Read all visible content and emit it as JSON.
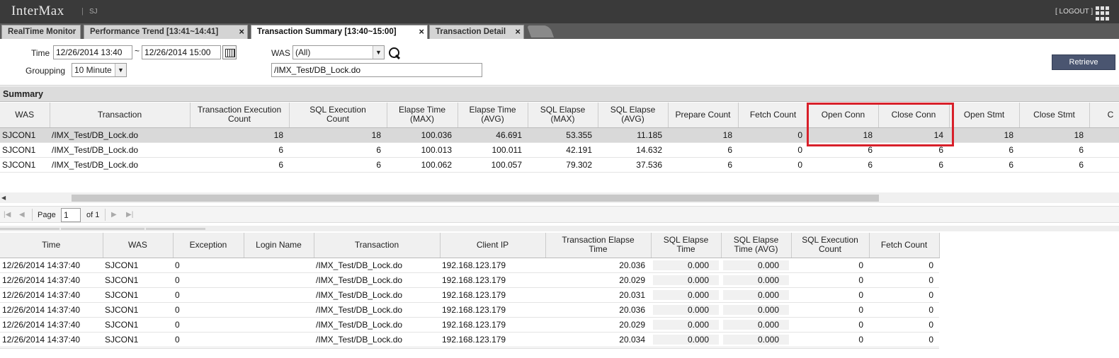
{
  "app": {
    "logo": "InterMax",
    "separator": "|",
    "user": "SJ",
    "logout": "[ LOGOUT ]"
  },
  "tabs": [
    {
      "label": "RealTime Monitor"
    },
    {
      "label": "Performance Trend [13:41~14:41]",
      "close": "×"
    },
    {
      "label": "Transaction Summary [13:40~15:00]",
      "close": "×"
    },
    {
      "label": "Transaction Detail",
      "close": "×"
    }
  ],
  "filter": {
    "time_label": "Time",
    "time_from": "12/26/2014 13:40",
    "time_sep": "~",
    "time_to": "12/26/2014 15:00",
    "grouping_label": "Groupping",
    "grouping_value": "10 Minute",
    "was_label": "WAS",
    "was_value": "(All)",
    "transaction_filter": "/IMX_Test/DB_Lock.do",
    "retrieve_label": "Retrieve"
  },
  "summary": {
    "title": "Summary",
    "columns": [
      [
        "WAS"
      ],
      [
        "Transaction"
      ],
      [
        "Transaction Execution",
        "Count"
      ],
      [
        "SQL Execution",
        "Count"
      ],
      [
        "Elapse Time",
        "(MAX)"
      ],
      [
        "Elapse Time",
        "(AVG)"
      ],
      [
        "SQL Elapse",
        "(MAX)"
      ],
      [
        "SQL Elapse",
        "(AVG)"
      ],
      [
        "Prepare Count"
      ],
      [
        "Fetch Count"
      ],
      [
        "Open Conn"
      ],
      [
        "Close Conn"
      ],
      [
        "Open Stmt"
      ],
      [
        "Close Stmt"
      ],
      [
        "C"
      ]
    ],
    "rows": [
      [
        "SJCON1",
        "/IMX_Test/DB_Lock.do",
        "18",
        "18",
        "100.036",
        "46.691",
        "53.355",
        "11.185",
        "18",
        "0",
        "18",
        "14",
        "18",
        "18",
        ""
      ],
      [
        "SJCON1",
        "/IMX_Test/DB_Lock.do",
        "6",
        "6",
        "100.013",
        "100.011",
        "42.191",
        "14.632",
        "6",
        "0",
        "6",
        "6",
        "6",
        "6",
        ""
      ],
      [
        "SJCON1",
        "/IMX_Test/DB_Lock.do",
        "6",
        "6",
        "100.062",
        "100.057",
        "79.302",
        "37.536",
        "6",
        "0",
        "6",
        "6",
        "6",
        "6",
        ""
      ]
    ]
  },
  "pager": {
    "page_label": "Page",
    "page_value": "1",
    "of_label": "of 1"
  },
  "detail": {
    "columns": [
      [
        "Time"
      ],
      [
        "WAS"
      ],
      [
        "Exception"
      ],
      [
        "Login Name"
      ],
      [
        "Transaction"
      ],
      [
        "Client IP"
      ],
      [
        "Transaction Elapse",
        "Time"
      ],
      [
        "SQL Elapse",
        "Time"
      ],
      [
        "SQL Elapse",
        "Time (AVG)"
      ],
      [
        "SQL Execution",
        "Count"
      ],
      [
        "Fetch Count"
      ]
    ],
    "rows": [
      [
        "12/26/2014 14:37:40",
        "SJCON1",
        "0",
        "",
        "/IMX_Test/DB_Lock.do",
        "192.168.123.179",
        "20.036",
        "0.000",
        "0.000",
        "0",
        "0"
      ],
      [
        "12/26/2014 14:37:40",
        "SJCON1",
        "0",
        "",
        "/IMX_Test/DB_Lock.do",
        "192.168.123.179",
        "20.029",
        "0.000",
        "0.000",
        "0",
        "0"
      ],
      [
        "12/26/2014 14:37:40",
        "SJCON1",
        "0",
        "",
        "/IMX_Test/DB_Lock.do",
        "192.168.123.179",
        "20.031",
        "0.000",
        "0.000",
        "0",
        "0"
      ],
      [
        "12/26/2014 14:37:40",
        "SJCON1",
        "0",
        "",
        "/IMX_Test/DB_Lock.do",
        "192.168.123.179",
        "20.036",
        "0.000",
        "0.000",
        "0",
        "0"
      ],
      [
        "12/26/2014 14:37:40",
        "SJCON1",
        "0",
        "",
        "/IMX_Test/DB_Lock.do",
        "192.168.123.179",
        "20.029",
        "0.000",
        "0.000",
        "0",
        "0"
      ],
      [
        "12/26/2014 14:37:40",
        "SJCON1",
        "0",
        "",
        "/IMX_Test/DB_Lock.do",
        "192.168.123.179",
        "20.034",
        "0.000",
        "0.000",
        "0",
        "0"
      ]
    ]
  },
  "colors": {
    "highlight_box": "#d8202a",
    "topbar": "#3a3a3a",
    "retrieve": "#4a5570"
  }
}
